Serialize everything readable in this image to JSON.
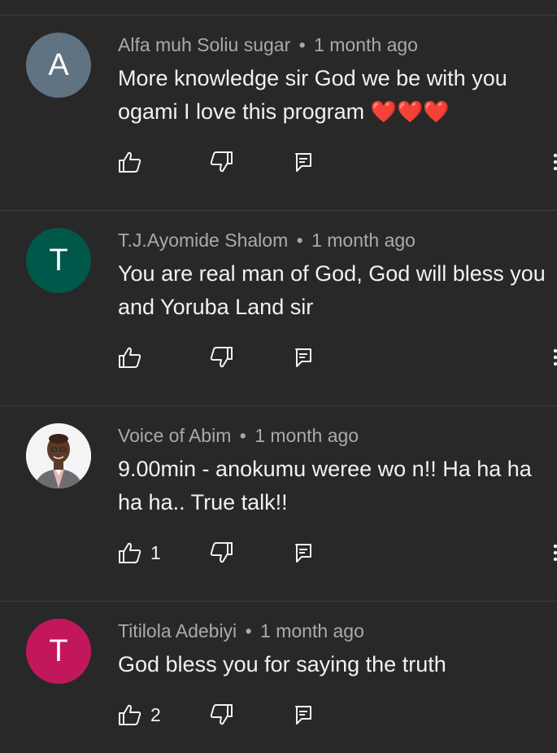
{
  "comments": [
    {
      "author": "Alfa muh Soliu sugar",
      "separator": "•",
      "time": "1 month ago",
      "avatar_letter": "A",
      "avatar_color": "#607383",
      "lines": [
        "More knowledge sir God we be with you",
        "ogami I love this program "
      ],
      "hearts": "❤️❤️❤️",
      "likes": ""
    },
    {
      "author": "T.J.Ayomide Shalom",
      "separator": "•",
      "time": "1 month ago",
      "avatar_letter": "T",
      "avatar_color": "#00584a",
      "lines": [
        "You are real man of God, God will bless you",
        "and Yoruba Land sir"
      ],
      "likes": ""
    },
    {
      "author": "Voice of Abim",
      "separator": "•",
      "time": "1 month ago",
      "avatar_letter": "",
      "avatar_color": "#ffffff",
      "lines": [
        "9.00min - anokumu weree wo n!! Ha ha ha",
        "ha ha.. True talk!!"
      ],
      "likes": "1"
    },
    {
      "author": "Titilola Adebiyi",
      "separator": "•",
      "time": "1 month ago",
      "avatar_letter": "T",
      "avatar_color": "#c2185b",
      "lines": [
        "God bless you for saying the truth"
      ],
      "likes": "2"
    }
  ]
}
